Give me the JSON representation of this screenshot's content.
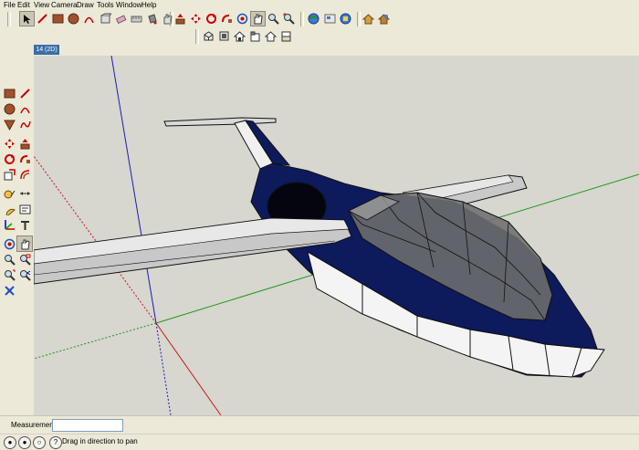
{
  "menu": [
    "File",
    "Edit",
    "View",
    "Camera",
    "Draw",
    "Tools",
    "Window",
    "Help"
  ],
  "scene_tab": "14 (2D)",
  "toolbar_top": {
    "icons": [
      "select-icon",
      "eraser-icon",
      "rectangle-icon",
      "circle-icon",
      "line-icon",
      "pencil-icon",
      "eraser-tool-icon",
      "component-icon",
      "paint-bucket-icon",
      "push-pull-icon",
      "move-icon",
      "rotate-icon",
      "follow-me-icon",
      "orbit-icon",
      "pan-icon",
      "zoom-icon",
      "zoom-extents-icon",
      "previous-view-icon",
      "next-view-icon",
      "warehouse-icon",
      "component-browser-icon"
    ]
  },
  "toolbar_views": {
    "icons": [
      "iso-view-icon",
      "top-view-icon",
      "front-view-icon",
      "right-view-icon",
      "back-view-icon",
      "left-view-icon"
    ]
  },
  "toolbar_left": {
    "icons": [
      "rectangle-icon",
      "line-icon",
      "circle-icon",
      "arc-icon",
      "polygon-icon",
      "freehand-icon",
      "move-icon",
      "push-pull-icon",
      "rotate-icon",
      "follow-me-icon",
      "scale-icon",
      "offset-icon",
      "tape-measure-icon",
      "dimension-icon",
      "protractor-icon",
      "text-icon",
      "axes-icon",
      "3d-text-icon",
      "orbit-icon",
      "pan-icon",
      "zoom-icon",
      "zoom-window-icon",
      "zoom-extents-icon",
      "previous-icon",
      "position-camera-icon",
      "look-around-icon"
    ]
  },
  "measurements": {
    "label": "Measurements",
    "value": ""
  },
  "status": {
    "text": "Drag in direction to pan",
    "buttons": [
      "geo-location-icon",
      "credits-icon",
      "user-icon",
      "help-icon"
    ]
  },
  "colors": {
    "sky_bg": "#d7d6cf",
    "fuselage": "#0d1a5c",
    "axis_red": "#c21a1a",
    "axis_green": "#1a9a1a",
    "axis_blue": "#1a1ab8"
  }
}
